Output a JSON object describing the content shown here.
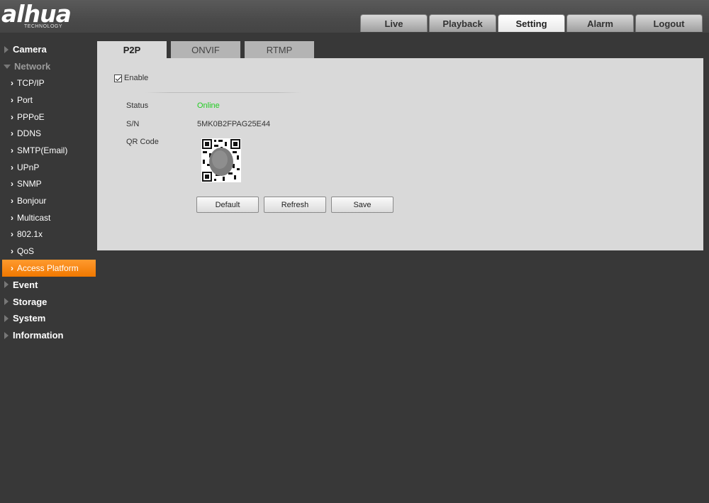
{
  "brand": {
    "name": "alhua",
    "sub": "TECHNOLOGY"
  },
  "nav": {
    "tabs": [
      {
        "label": "Live"
      },
      {
        "label": "Playback"
      },
      {
        "label": "Setting",
        "active": true
      },
      {
        "label": "Alarm"
      },
      {
        "label": "Logout"
      }
    ]
  },
  "sidebar": {
    "camera": "Camera",
    "network": "Network",
    "network_items": [
      "TCP/IP",
      "Port",
      "PPPoE",
      "DDNS",
      "SMTP(Email)",
      "UPnP",
      "SNMP",
      "Bonjour",
      "Multicast",
      "802.1x",
      "QoS",
      "Access Platform"
    ],
    "selected_item": "Access Platform",
    "event": "Event",
    "storage": "Storage",
    "system": "System",
    "information": "Information"
  },
  "content_tabs": [
    {
      "label": "P2P",
      "active": true
    },
    {
      "label": "ONVIF"
    },
    {
      "label": "RTMP"
    }
  ],
  "p2p": {
    "enable_label": "Enable",
    "enable_checked": true,
    "status_label": "Status",
    "status_value": "Online",
    "sn_label": "S/N",
    "sn_value": "5MK0B2FPAG25E44",
    "qr_label": "QR Code",
    "buttons": {
      "default": "Default",
      "refresh": "Refresh",
      "save": "Save"
    }
  },
  "colors": {
    "background": "#383838",
    "selected_item": "#f58a1e",
    "status_online": "#22cc22",
    "panel": "#d9d9d9"
  }
}
